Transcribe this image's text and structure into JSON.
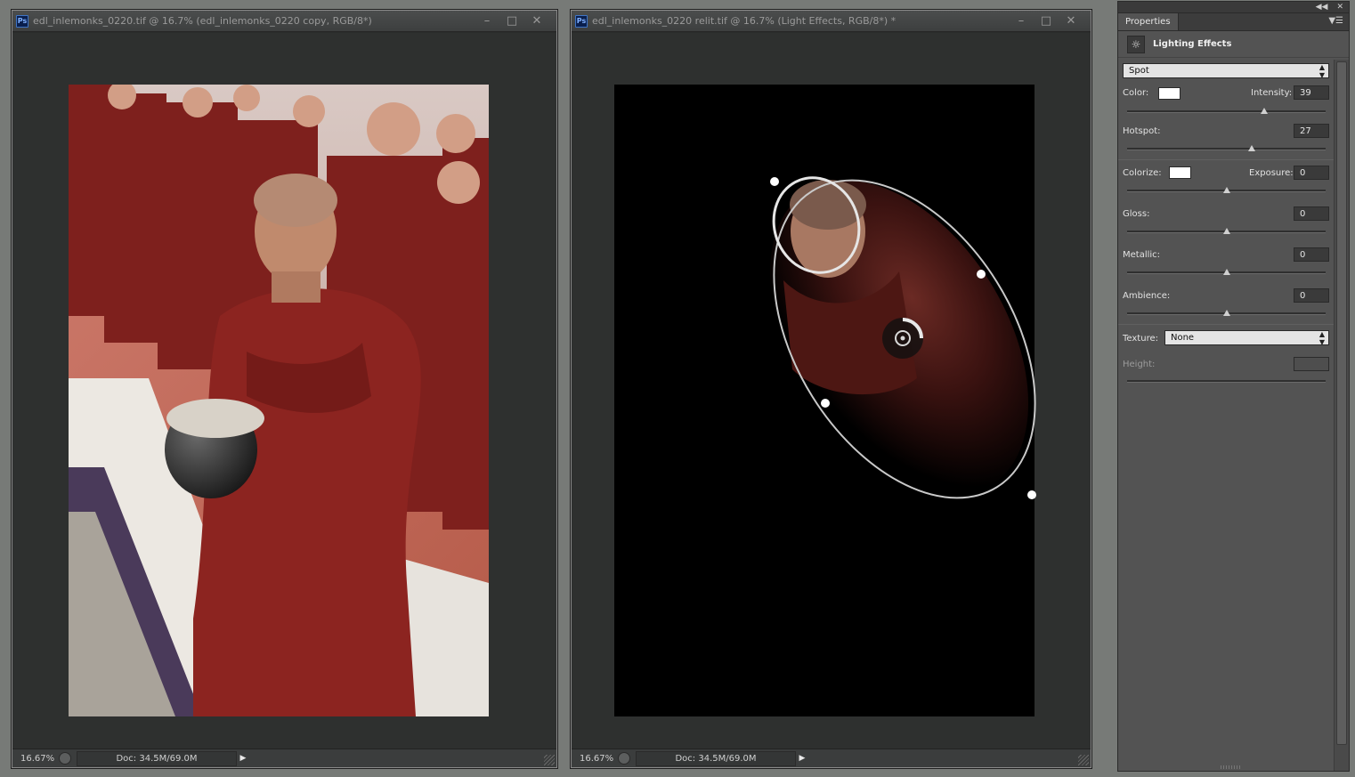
{
  "windows": [
    {
      "title": "edl_inlemonks_0220.tif @ 16.7% (edl_inlemonks_0220 copy, RGB/8*)",
      "zoom": "16.67%",
      "doc": "Doc: 34.5M/69.0M"
    },
    {
      "title": "edl_inlemonks_0220 relit.tif @ 16.7% (Light Effects, RGB/8*) *",
      "zoom": "16.67%",
      "doc": "Doc: 34.5M/69.0M"
    }
  ],
  "ps_icon": "Ps",
  "window_buttons": {
    "minimize": "–",
    "maximize": "□",
    "close": "✕"
  },
  "status_arrow": "▶",
  "panel": {
    "tab": "Properties",
    "header": "Lighting Effects",
    "light_type": "Spot",
    "color_label": "Color:",
    "intensity_label": "Intensity:",
    "intensity": "39",
    "intensity_level": 0.69,
    "hotspot_label": "Hotspot:",
    "hotspot": "27",
    "hotspot_level": 0.63,
    "colorize_label": "Colorize:",
    "exposure_label": "Exposure:",
    "exposure": "0",
    "exposure_level": 0.5,
    "gloss_label": "Gloss:",
    "gloss": "0",
    "gloss_level": 0.5,
    "metallic_label": "Metallic:",
    "metallic": "0",
    "metallic_level": 0.5,
    "ambience_label": "Ambience:",
    "ambience": "0",
    "ambience_level": 0.5,
    "texture_label": "Texture:",
    "texture": "None",
    "height_label": "Height:"
  },
  "icons": {
    "app": "photoshop-icon",
    "lighting": "lighting-effects-icon",
    "collapse": "collapse-panels-icon",
    "close": "close-panel-icon",
    "menu": "panel-menu-icon"
  },
  "colors": {
    "light_color": "#ffffff",
    "colorize_color": "#ffffff",
    "robe": "#7a1f1c",
    "canvas_bg": "#2e302f"
  }
}
